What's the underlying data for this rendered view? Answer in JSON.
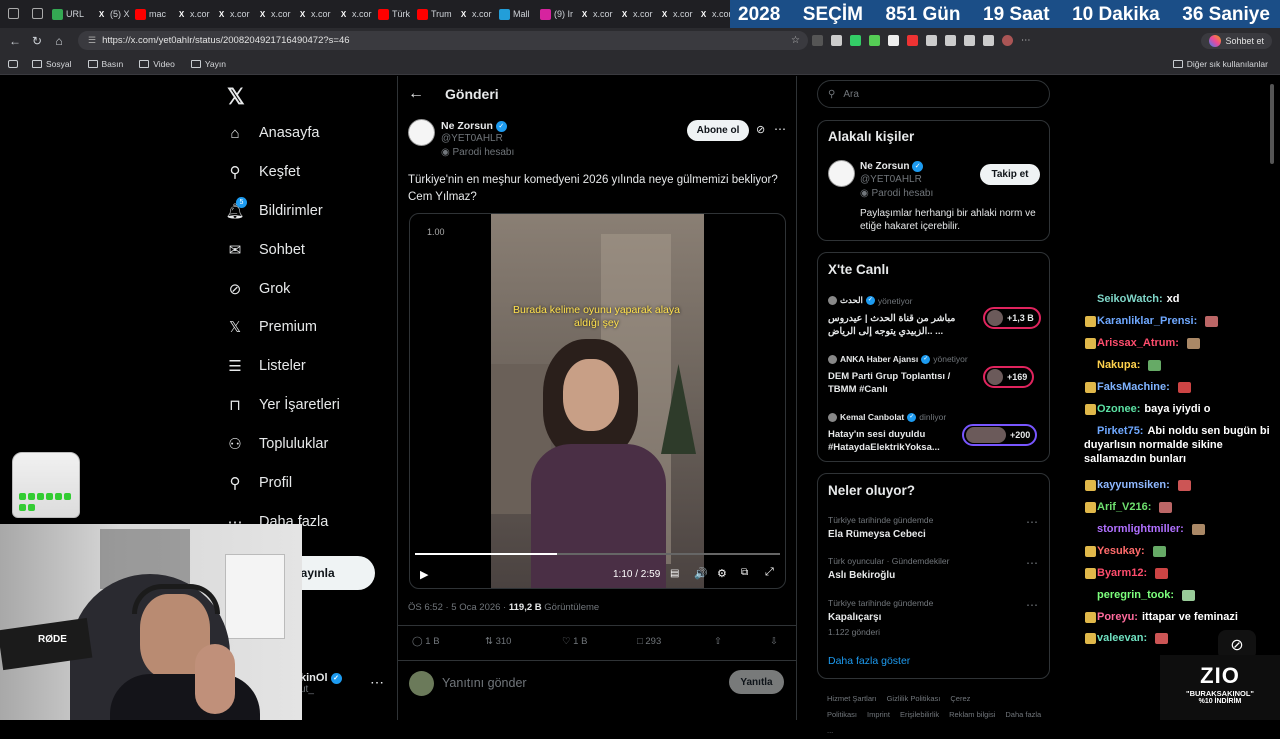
{
  "browser": {
    "tabs": [
      {
        "label": "URL",
        "icon": "url-icon",
        "color": "#34a853"
      },
      {
        "label": "(5) X",
        "icon": "x-icon",
        "color": "#000000"
      },
      {
        "label": "mac",
        "icon": "youtube-icon",
        "color": "#ff0000"
      },
      {
        "label": "x.cor",
        "icon": "x-icon",
        "color": "#000000"
      },
      {
        "label": "x.cor",
        "icon": "x-icon",
        "color": "#000000"
      },
      {
        "label": "x.cor",
        "icon": "x-icon",
        "color": "#000000"
      },
      {
        "label": "x.cor",
        "icon": "x-icon",
        "color": "#000000"
      },
      {
        "label": "x.cor",
        "icon": "x-icon",
        "color": "#000000"
      },
      {
        "label": "Türk",
        "icon": "youtube-icon",
        "color": "#ff0000"
      },
      {
        "label": "Trum",
        "icon": "youtube-icon",
        "color": "#ff0000"
      },
      {
        "label": "x.cor",
        "icon": "x-icon",
        "color": "#000000"
      },
      {
        "label": "Mall",
        "icon": "telegram-icon",
        "color": "#229ed9"
      },
      {
        "label": "(9) Ir",
        "icon": "instagram-icon",
        "color": "#d6249f"
      },
      {
        "label": "x.cor",
        "icon": "x-icon",
        "color": "#000000"
      },
      {
        "label": "x.cor",
        "icon": "x-icon",
        "color": "#000000"
      },
      {
        "label": "x.cor",
        "icon": "x-icon",
        "color": "#000000"
      },
      {
        "label": "x.cor",
        "icon": "x-icon",
        "color": "#000000"
      }
    ],
    "url": "https://x.com/yet0ahlr/status/2008204921716490472?s=46",
    "chat_button": "Sohbet et",
    "bookmarks": [
      "Sosyal",
      "Basın",
      "Video",
      "Yayın"
    ],
    "other_bookmarks": "Diğer sık kullanılanlar"
  },
  "countdown": {
    "year": "2028",
    "label": "SEÇİM",
    "days": "851 Gün",
    "hours": "19 Saat",
    "minutes": "10 Dakika",
    "seconds": "36 Saniye",
    "bg_color": "#1b4e87"
  },
  "nav": {
    "items": [
      {
        "label": "Anasayfa",
        "icon": "home-icon"
      },
      {
        "label": "Keşfet",
        "icon": "search-icon"
      },
      {
        "label": "Bildirimler",
        "icon": "bell-icon",
        "badge": "5"
      },
      {
        "label": "Sohbet",
        "icon": "mail-icon"
      },
      {
        "label": "Grok",
        "icon": "grok-icon"
      },
      {
        "label": "Premium",
        "icon": "x-premium-icon"
      },
      {
        "label": "Listeler",
        "icon": "list-icon"
      },
      {
        "label": "Yer İşaretleri",
        "icon": "bookmark-icon"
      },
      {
        "label": "Topluluklar",
        "icon": "people-icon"
      },
      {
        "label": "Profil",
        "icon": "person-icon"
      },
      {
        "label": "Daha fazla",
        "icon": "more-circle-icon"
      }
    ],
    "post_button": "yayınla",
    "account_name": "kinOl",
    "account_handle": "ut_"
  },
  "post": {
    "header": "Gönderi",
    "author_name": "Ne Zorsun",
    "author_handle": "@YET0AHLR",
    "parody_label": "Parodi hesabı",
    "follow_button": "Abone ol",
    "text": "Türkiye'nin en meşhur komedyeni 2026 yılında neye gülmemizi bekliyor? Cem Yılmaz?",
    "video": {
      "speed": "1.00",
      "caption": "Burada kelime oyunu yaparak alaya aldığı şey",
      "time": "1:10 / 2:59",
      "progress": 0.39
    },
    "meta_time": "ÖS 6:52 · 5 Oca 2026 ·",
    "views_count": "119,2 B",
    "views_label": "Görüntüleme",
    "stats": {
      "replies": "1 B",
      "reposts": "310",
      "likes": "1 B",
      "bookmarks": "293"
    },
    "reply_placeholder": "Yanıtını gönder",
    "reply_button": "Yanıtla"
  },
  "sidebar": {
    "search_placeholder": "Ara",
    "related": {
      "title": "Alakalı kişiler",
      "name": "Ne Zorsun",
      "handle": "@YET0AHLR",
      "parody": "Parodi hesabı",
      "bio": "Paylaşımlar herhangi bir ahlaki norm ve etiğe hakaret içerebilir.",
      "follow_button": "Takip et"
    },
    "live": {
      "title": "X'te Canlı",
      "items": [
        {
          "host": "الحدث",
          "status": "yönetiyor",
          "title": "مباشر من قناة الحدث | عيدروس الزبيدي يتوجه إلى الرياض.. ...",
          "count": "+1,3 B",
          "ring": "#e0245e"
        },
        {
          "host": "ANKA Haber Ajansı",
          "status": "yönetiyor",
          "title": "DEM Parti Grup Toplantısı / TBMM #Canlı",
          "count": "+169",
          "ring": "#e0245e"
        },
        {
          "host": "Kemal Canbolat",
          "status": "dinliyor",
          "title": "Hatay'ın sesi duyuldu #HataydaElektrikYoksa...",
          "count": "+200",
          "ring": "#7856ff"
        }
      ]
    },
    "trends": {
      "title": "Neler oluyor?",
      "items": [
        {
          "context": "Türkiye tarihinde gündemde",
          "name": "Ela Rümeysa Cebeci",
          "posts": ""
        },
        {
          "context": "Türk oyuncular · Gündemdekiler",
          "name": "Aslı Bekiroğlu",
          "posts": ""
        },
        {
          "context": "Türkiye tarihinde gündemde",
          "name": "Kapalıçarşı",
          "posts": "1.122 gönderi"
        }
      ],
      "show_more": "Daha fazla göster"
    },
    "footer": [
      "Hizmet Şartları",
      "Gizlilik Politikası",
      "Çerez Politikası",
      "Imprint",
      "Erişilebilirlik",
      "Reklam bilgisi",
      "Daha fazla ..."
    ]
  },
  "chat": [
    {
      "user": "SeikoWatch:",
      "msg": "xd",
      "color": "#7fd6c8"
    },
    {
      "user": "Karanliklar_Prensi:",
      "msg": "",
      "color": "#6fa8ff"
    },
    {
      "user": "Arissax_Atrum:",
      "msg": "",
      "color": "#ff4d6d"
    },
    {
      "user": "Nakupa:",
      "msg": "",
      "color": "#ffd24d"
    },
    {
      "user": "FaksMachine:",
      "msg": "",
      "color": "#7fb3ff"
    },
    {
      "user": "Ozonee:",
      "msg": "baya iyiydi o",
      "color": "#5be0a3"
    },
    {
      "user": "Pirket75:",
      "msg": "Abi noldu sen bugün bi duyarlısın normalde sikine sallamazdın bunları",
      "color": "#6fa8ff"
    },
    {
      "user": "kayyumsiken:",
      "msg": "",
      "color": "#8fb8ff"
    },
    {
      "user": "Arif_V216:",
      "msg": "",
      "color": "#6fe06f"
    },
    {
      "user": "stormlightmiller:",
      "msg": "",
      "color": "#b070ff"
    },
    {
      "user": "Yesukay:",
      "msg": "",
      "color": "#ff6b6b"
    },
    {
      "user": "Byarm12:",
      "msg": "",
      "color": "#ff4d6d"
    },
    {
      "user": "peregrin_took:",
      "msg": "",
      "color": "#7dff7d"
    },
    {
      "user": "Poreyu:",
      "msg": "ittapar ve feminazi",
      "color": "#ff6b9d"
    },
    {
      "user": "valeevan:",
      "msg": "",
      "color": "#6fe0c0"
    }
  ],
  "overlay": {
    "brand": "ZIO",
    "code": "\"BURAKSAKINOL\"",
    "discount": "%10 İNDİRİM",
    "webcam_mic": "RØDE"
  }
}
